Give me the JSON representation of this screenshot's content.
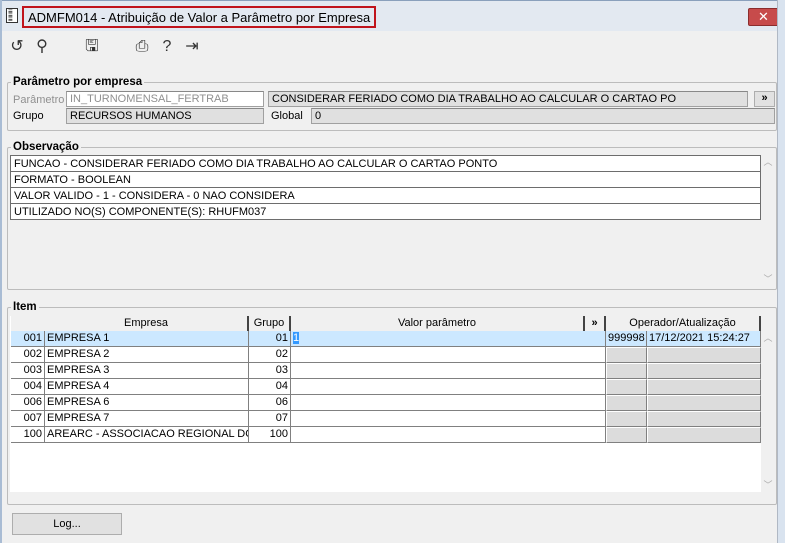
{
  "window": {
    "title": "ADMFM014 - Atribuição de Valor a Parâmetro por Empresa",
    "close": "✕"
  },
  "toolbar": [
    {
      "icon": "undo-icon",
      "glyph": "↺"
    },
    {
      "icon": "search-icon",
      "glyph": "⚲"
    },
    {
      "icon": "save-icon",
      "glyph": "🖫"
    },
    {
      "icon": "print-icon",
      "glyph": "⎙"
    },
    {
      "icon": "help-icon",
      "glyph": "?"
    },
    {
      "icon": "exit-icon",
      "glyph": "⇥"
    }
  ],
  "param": {
    "legend": "Parâmetro por empresa",
    "param_label": "Parâmetro",
    "param_value": "IN_TURNOMENSAL_FERTRAB",
    "description": "CONSIDERAR FERIADO COMO DIA TRABALHO AO CALCULAR O CARTAO PO",
    "expand": "»",
    "grupo_label": "Grupo",
    "grupo_value": "RECURSOS HUMANOS",
    "global_label": "Global",
    "global_value": "0"
  },
  "obs": {
    "legend": "Observação",
    "lines": [
      "FUNCAO - CONSIDERAR FERIADO COMO DIA TRABALHO AO CALCULAR O CARTAO PONTO",
      "FORMATO - BOOLEAN",
      "VALOR VALIDO - 1 - CONSIDERA - 0 NAO CONSIDERA",
      "UTILIZADO NO(S) COMPONENTE(S): RHUFM037"
    ]
  },
  "item": {
    "legend": "Item",
    "headers": {
      "empresa": "Empresa",
      "grupo": "Grupo",
      "valor": "Valor parâmetro",
      "expand": "»",
      "operador": "Operador/Atualização"
    },
    "rows": [
      {
        "code": "001",
        "empresa": "EMPRESA 1",
        "grupo": "01",
        "valor": "1",
        "operador": "999998",
        "data": "17/12/2021 15:24:27"
      },
      {
        "code": "002",
        "empresa": "EMPRESA 2",
        "grupo": "02",
        "valor": "",
        "operador": "",
        "data": ""
      },
      {
        "code": "003",
        "empresa": "EMPRESA 3",
        "grupo": "03",
        "valor": "",
        "operador": "",
        "data": ""
      },
      {
        "code": "004",
        "empresa": "EMPRESA 4",
        "grupo": "04",
        "valor": "",
        "operador": "",
        "data": ""
      },
      {
        "code": "006",
        "empresa": "EMPRESA 6",
        "grupo": "06",
        "valor": "",
        "operador": "",
        "data": ""
      },
      {
        "code": "007",
        "empresa": "EMPRESA 7",
        "grupo": "07",
        "valor": "",
        "operador": "",
        "data": ""
      },
      {
        "code": "100",
        "empresa": "AREARC - ASSOCIACAO REGIONAL DOS",
        "grupo": "100",
        "valor": "",
        "operador": "",
        "data": ""
      }
    ]
  },
  "footer": {
    "log": "Log..."
  },
  "colors": {
    "selected_row": "#cce8ff",
    "title_highlight": "#c0141c",
    "close": "#c74b4b"
  }
}
